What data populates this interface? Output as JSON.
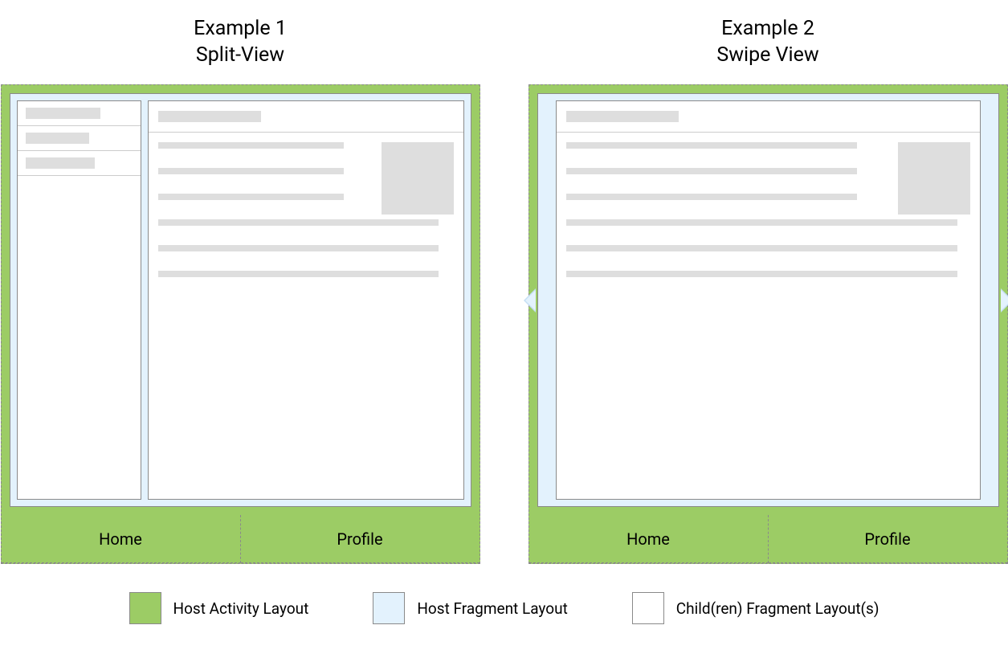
{
  "examples": {
    "left": {
      "title_line1": "Example 1",
      "title_line2": "Split-View",
      "tabs": {
        "home": "Home",
        "profile": "Profile"
      }
    },
    "right": {
      "title_line1": "Example 2",
      "title_line2": "Swipe View",
      "tabs": {
        "home": "Home",
        "profile": "Profile"
      }
    }
  },
  "legend": {
    "host_activity": "Host Activity Layout",
    "host_fragment": "Host Fragment Layout",
    "child_fragment": "Child(ren) Fragment Layout(s)"
  },
  "colors": {
    "host_activity": "#9ccc65",
    "host_fragment": "#e3f2fd",
    "child_fragment": "#ffffff",
    "placeholder": "#dedede"
  }
}
